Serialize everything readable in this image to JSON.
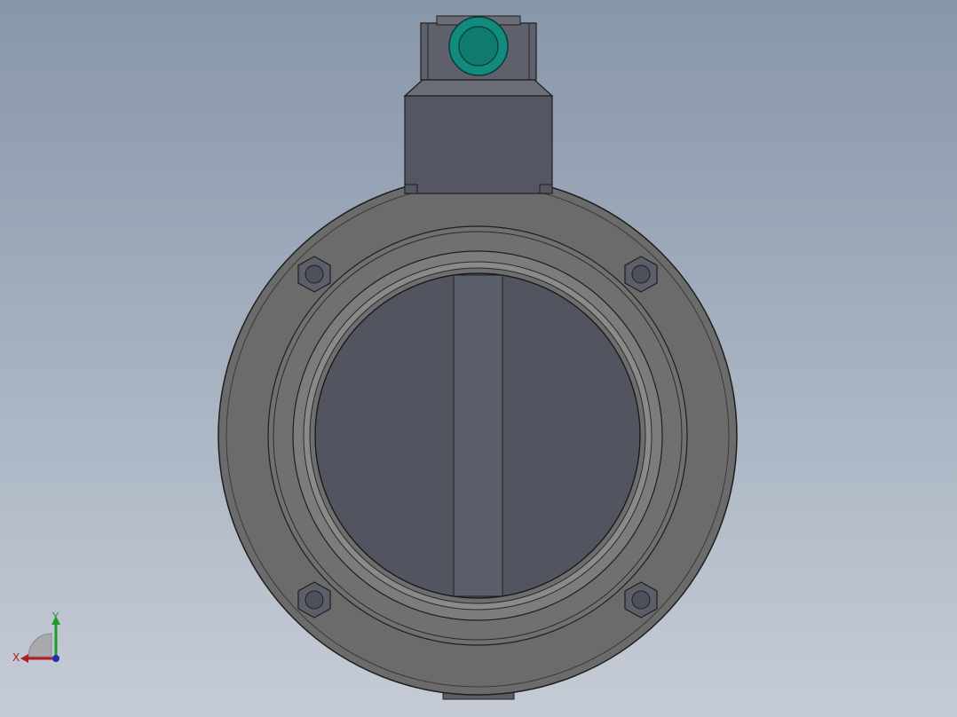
{
  "viewport": {
    "background_top": "#8796a9",
    "background_bottom": "#c6ccd6"
  },
  "model": {
    "name": "butterfly valve",
    "body_color": "#6b6b6b",
    "disc_color": "#52555f",
    "stem_color": "#5b5f6c",
    "knob_color": "#138a7e"
  },
  "triad": {
    "x_label": "X",
    "y_label": "Y",
    "x_color": "#b01e1e",
    "y_color": "#1e9a2c",
    "z_color": "#1f2fae"
  }
}
